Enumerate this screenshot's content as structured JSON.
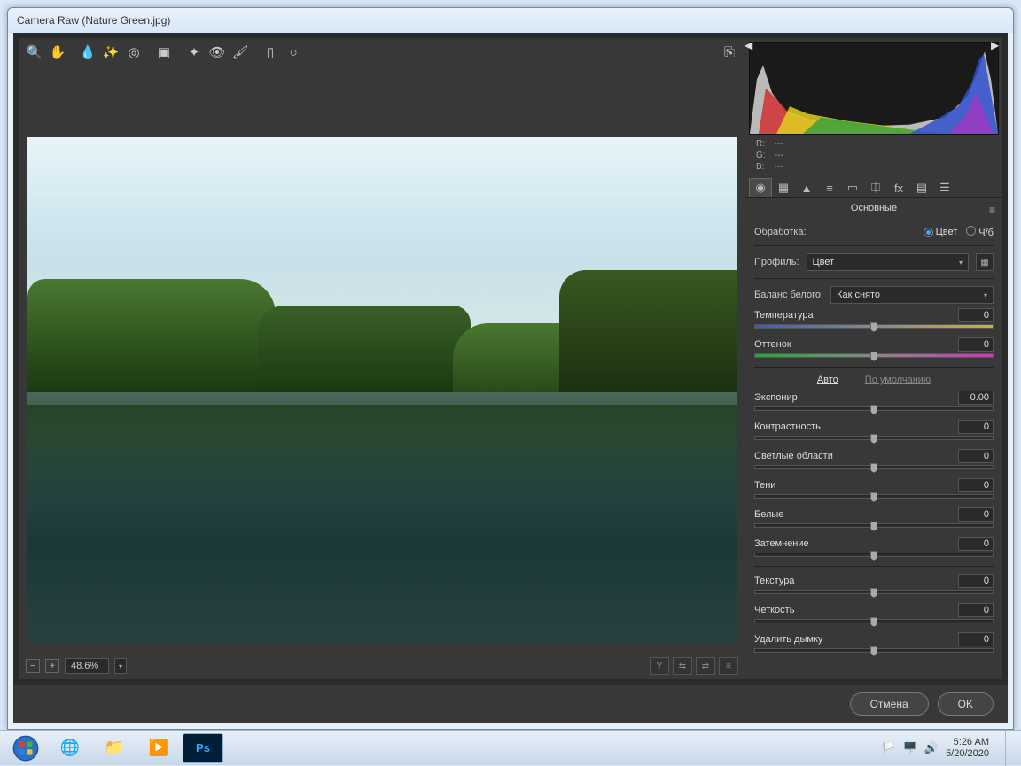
{
  "window": {
    "title": "Camera Raw (Nature Green.jpg)"
  },
  "rgb": {
    "r_label": "R:",
    "g_label": "G:",
    "b_label": "B:",
    "na": "---"
  },
  "panel": {
    "title": "Основные",
    "treatment_label": "Обработка:",
    "treatment_color": "Цвет",
    "treatment_bw": "Ч/б",
    "profile_label": "Профиль:",
    "profile_value": "Цвет",
    "wb_label": "Баланс белого:",
    "wb_value": "Как снято",
    "auto": "Авто",
    "default": "По умолчанию"
  },
  "sliders": {
    "temperature": {
      "label": "Температура",
      "value": "0"
    },
    "tint": {
      "label": "Оттенок",
      "value": "0"
    },
    "exposure": {
      "label": "Экспонир",
      "value": "0.00"
    },
    "contrast": {
      "label": "Контрастность",
      "value": "0"
    },
    "highlights": {
      "label": "Светлые области",
      "value": "0"
    },
    "shadows": {
      "label": "Тени",
      "value": "0"
    },
    "whites": {
      "label": "Белые",
      "value": "0"
    },
    "blacks": {
      "label": "Затемнение",
      "value": "0"
    },
    "texture": {
      "label": "Текстура",
      "value": "0"
    },
    "clarity": {
      "label": "Четкость",
      "value": "0"
    },
    "dehaze": {
      "label": "Удалить дымку",
      "value": "0"
    }
  },
  "zoom": {
    "value": "48.6%"
  },
  "buttons": {
    "cancel": "Отмена",
    "ok": "OK"
  },
  "taskbar": {
    "time": "5:26 AM",
    "date": "5/20/2020"
  }
}
